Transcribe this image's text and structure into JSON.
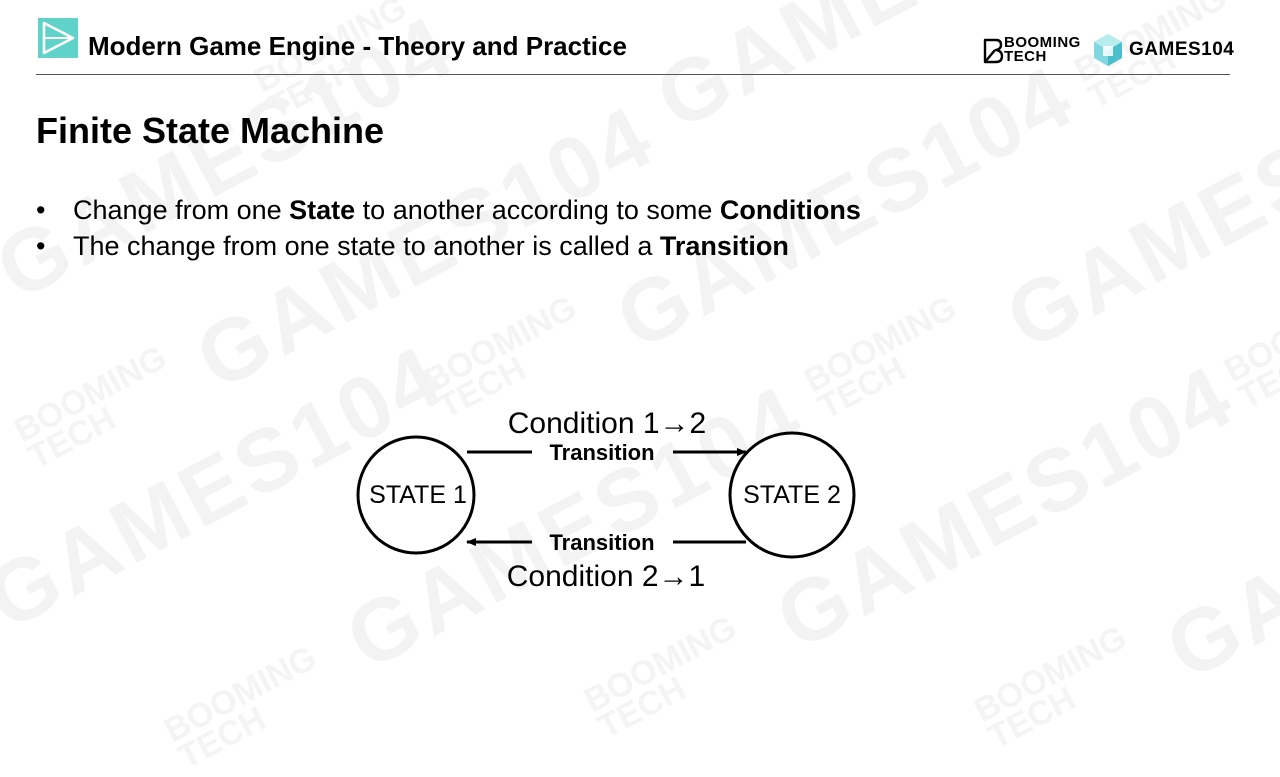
{
  "header": {
    "course_title": "Modern Game Engine - Theory and Practice",
    "brand_booming_line1": "BOOMING",
    "brand_booming_line2": "TECH",
    "brand_games": "GAMES104",
    "accent_color": "#5fd3c7"
  },
  "slide": {
    "title": "Finite State Machine",
    "bullets": [
      {
        "marker": "•",
        "parts": [
          "Change from one ",
          "State",
          " to another according to some ",
          "Conditions"
        ]
      },
      {
        "marker": "•",
        "parts": [
          "The change from one state to another is called a ",
          "Transition"
        ]
      }
    ]
  },
  "diagram": {
    "state1_label": "STATE 1",
    "state2_label": "STATE 2",
    "top_condition": "Condition 1→2",
    "top_transition": "Transition",
    "bottom_condition": "Condition 2→1",
    "bottom_transition": "Transition"
  },
  "watermark": {
    "big_text": "GAMES104",
    "small_text_line1": "BOOMING",
    "small_text_line2": "TECH"
  }
}
